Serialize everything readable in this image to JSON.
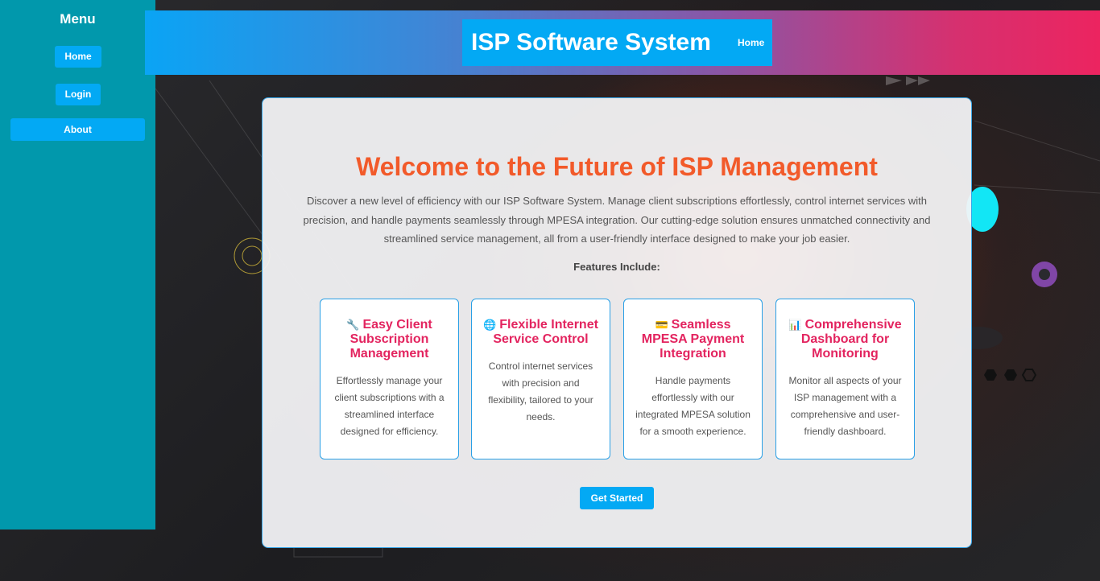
{
  "sidebar": {
    "title": "Menu",
    "items": [
      {
        "label": "Home"
      },
      {
        "label": "Login"
      },
      {
        "label": "About"
      }
    ]
  },
  "header": {
    "title": "ISP Software System",
    "home_link": "Home"
  },
  "main": {
    "title": "Welcome to the Future of ISP Management",
    "description": "Discover a new level of efficiency with our ISP Software System. Manage client subscriptions effortlessly, control internet services with precision, and handle payments seamlessly through MPESA integration. Our cutting-edge solution ensures unmatched connectivity and streamlined service management, all from a user-friendly interface designed to make your job easier.",
    "features_heading": "Features Include:",
    "features": [
      {
        "icon": "wrench-icon",
        "glyph": "🔧",
        "title": "Easy Client Subscription Management",
        "description": "Effortlessly manage your client subscriptions with a streamlined interface designed for efficiency."
      },
      {
        "icon": "globe-icon",
        "glyph": "🌐",
        "title": "Flexible Internet Service Control",
        "description": "Control internet services with precision and flexibility, tailored to your needs."
      },
      {
        "icon": "credit-card-icon",
        "glyph": "💳",
        "title": "Seamless MPESA Payment Integration",
        "description": "Handle payments effortlessly with our integrated MPESA solution for a smooth experience."
      },
      {
        "icon": "bar-chart-icon",
        "glyph": "📊",
        "title": "Comprehensive Dashboard for Monitoring",
        "description": "Monitor all aspects of your ISP management with a comprehensive and user-friendly dashboard."
      }
    ],
    "cta_label": "Get Started"
  },
  "colors": {
    "sidebar_bg": "#0198ac",
    "button_bg": "#03a9f4",
    "title_orange": "#f25a2a",
    "feature_title_pink": "#e3245f",
    "header_gradient_start": "#0aa4f5",
    "header_gradient_end": "#ec2460"
  }
}
